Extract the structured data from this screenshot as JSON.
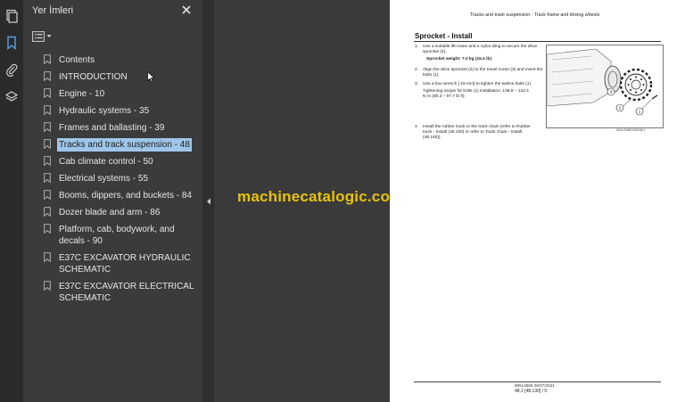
{
  "sidebar_panel": {
    "title": "Yer İmleri",
    "bookmarks": [
      "Contents",
      "INTRODUCTION",
      "Engine - 10",
      "Hydraulic systems - 35",
      "Frames and ballasting - 39",
      "Tracks and track suspension - 48",
      "Cab climate control - 50",
      "Electrical systems - 55",
      "Booms, dippers, and buckets - 84",
      "Dozer blade and arm - 86",
      "Platform, cab, bodywork, and decals - 90",
      "E37C EXCAVATOR HYDRAULIC SCHEMATIC",
      "E37C EXCAVATOR ELECTRICAL SCHEMATIC"
    ],
    "selected_index": 5
  },
  "watermark": "machinecatalogic.com",
  "page": {
    "header": "Tracks and track suspension - Track frame and driving wheels",
    "heading": "Sprocket - Install",
    "steps": [
      {
        "n": "1.",
        "text": "Use a suitable lift-crane and a nylon sling to secure the drive sprocket (2).",
        "sub": "Sprocket weight: 7.0 kg (15.4 lb)"
      },
      {
        "n": "2.",
        "text": "Align the drive sprocket (2) to the travel motor (3) and insert the bolts (1).",
        "sub": ""
      },
      {
        "n": "3.",
        "text": "Use a box wrench [ 19 mm] to tighten the twelve bolts (1).",
        "sub": "Tightening torque for bolts (1) installation: 108.9 – 132.4 N·m (80.3 – 97.7 lb ft)"
      },
      {
        "n": "4.",
        "text": "Install the rubber track or the track chain (refer to Rubber track - Install (48.100) or refer to Track chain - Install (48.100)).",
        "sub": ""
      }
    ],
    "figure_callouts": [
      "1",
      "2",
      "3"
    ],
    "figure_caption": "NHIL19WEX00168   1",
    "footer_code": "90514555 28/07/2021",
    "footer_page": "48.1 [48.130] / 5"
  }
}
